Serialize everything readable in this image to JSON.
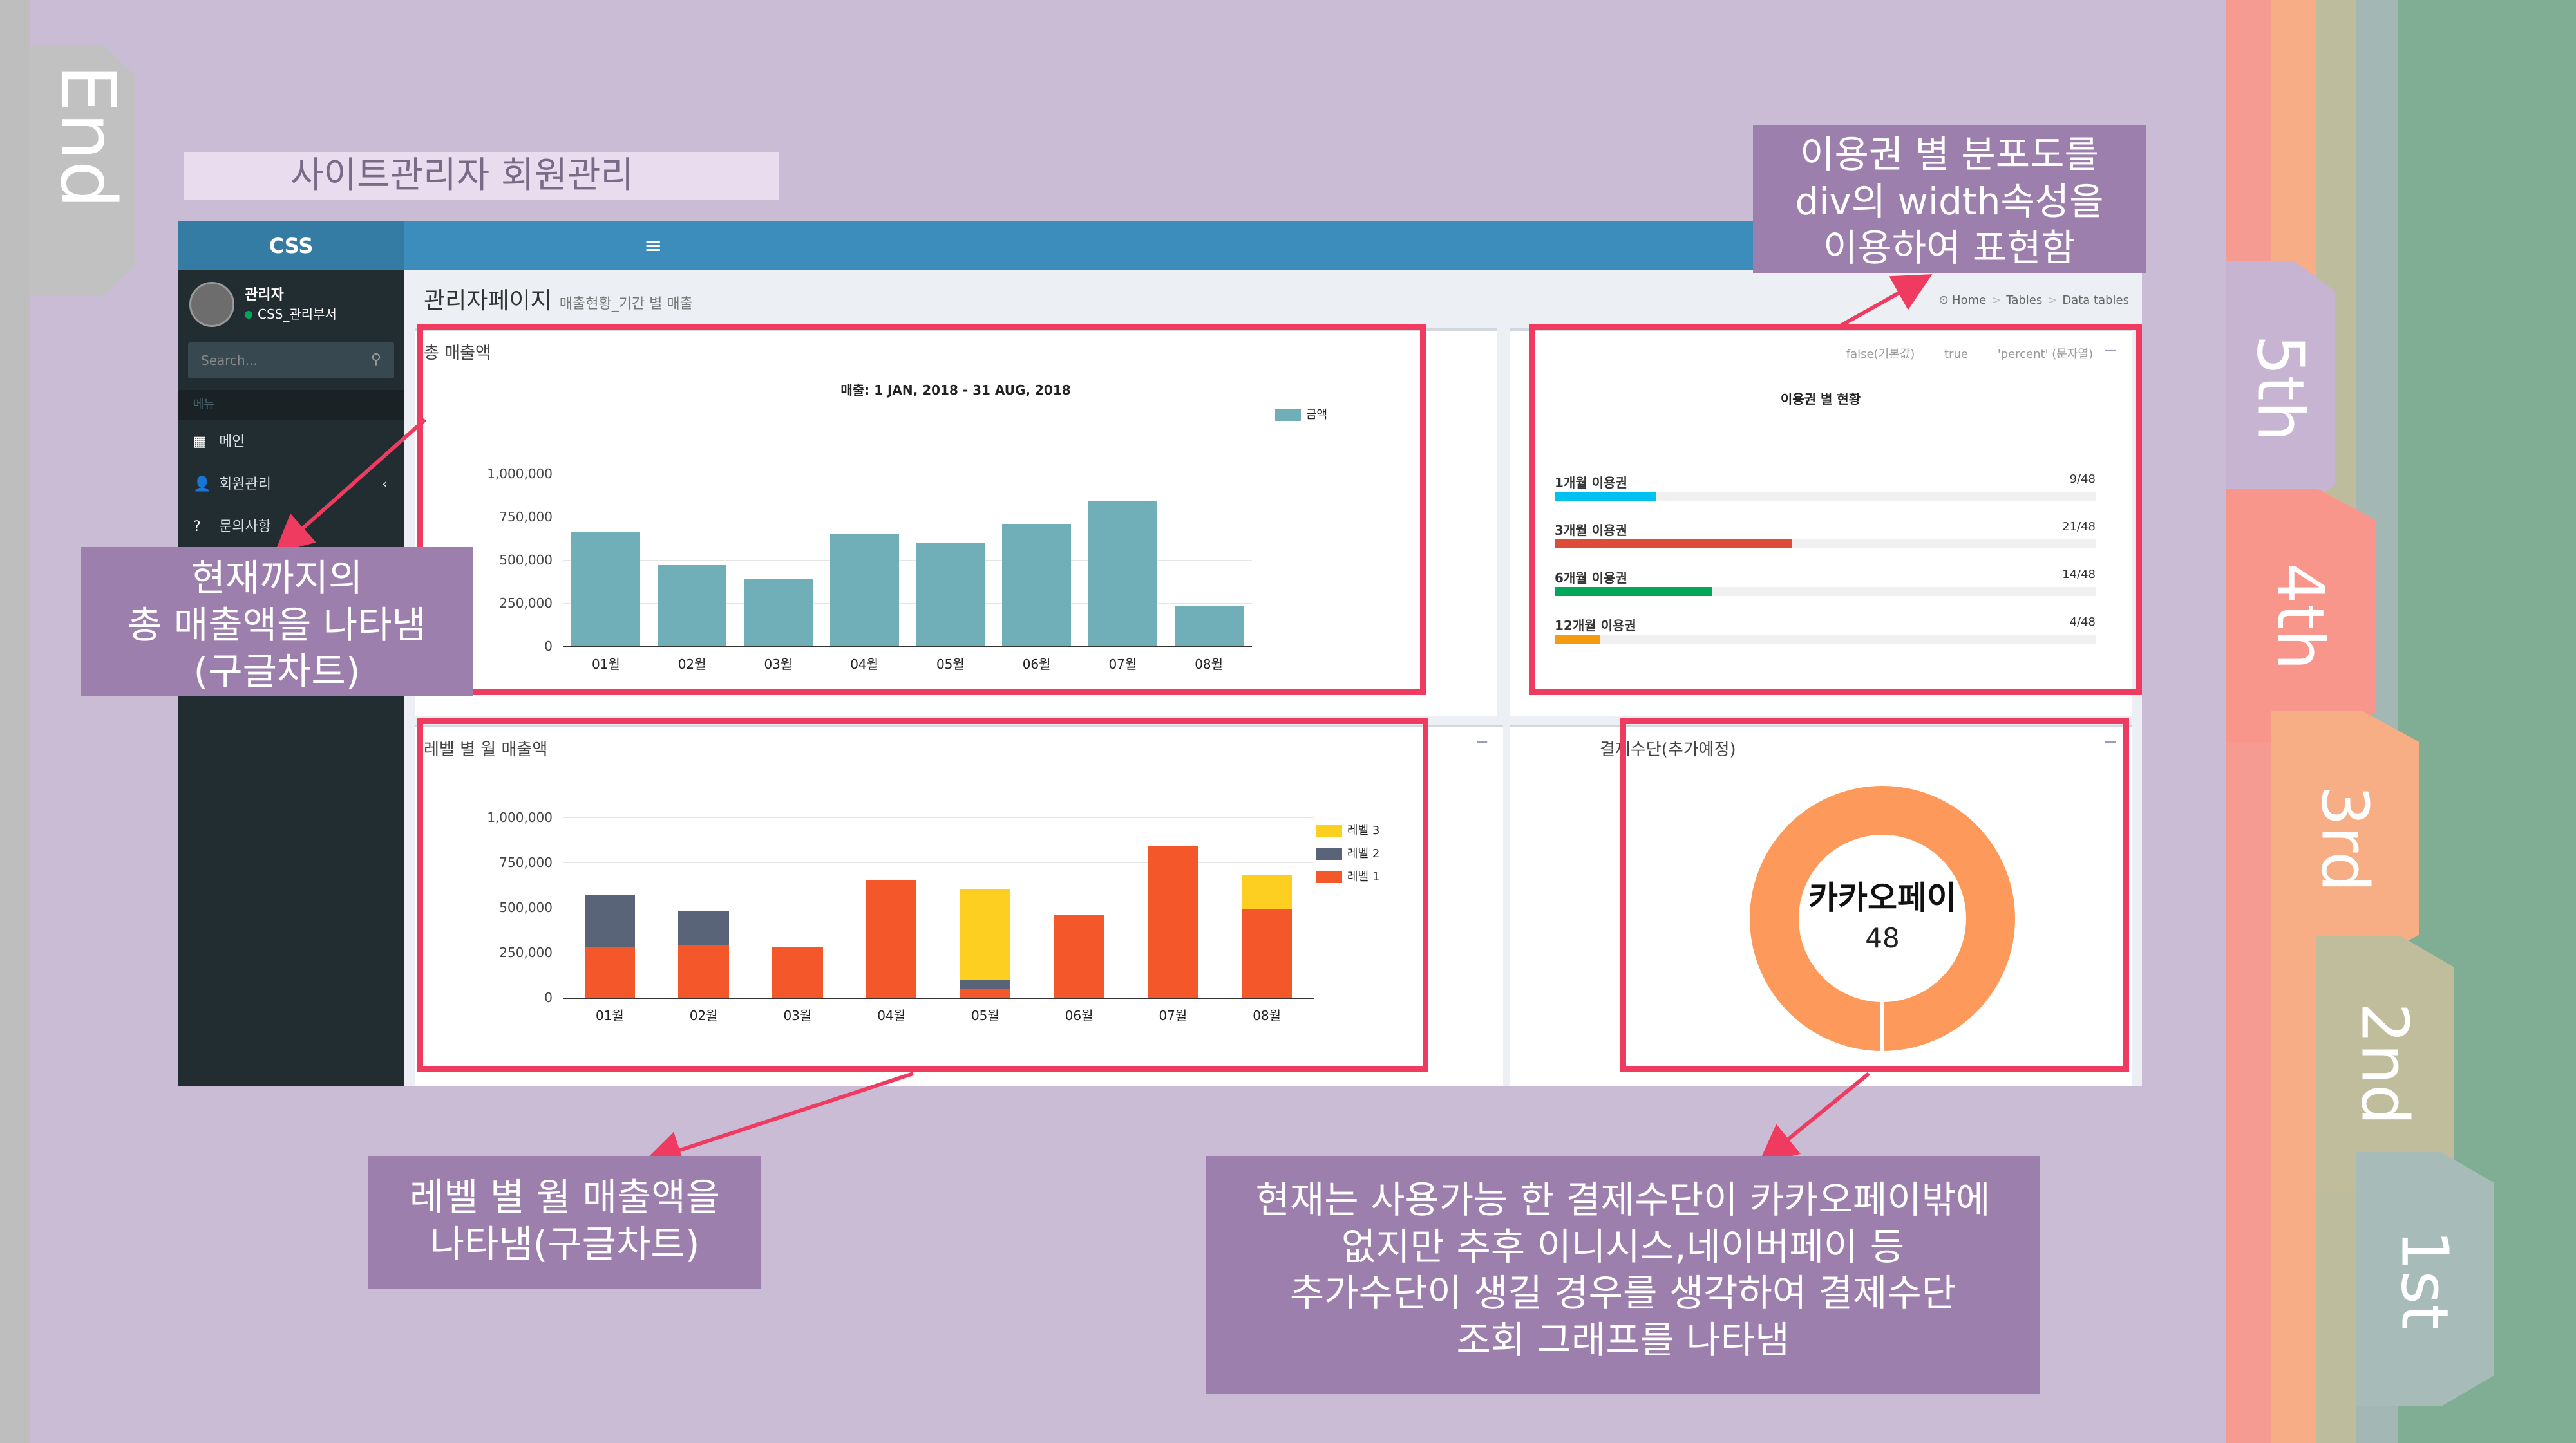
{
  "slide": {
    "title": "사이트관리자 회원관리",
    "end_tab": "End",
    "tabs": [
      "5th",
      "4th",
      "3rd",
      "2nd",
      "1st"
    ]
  },
  "admin": {
    "logo": "CSS",
    "hamburger": "≡",
    "user": {
      "name": "관리자",
      "dept": "CSS_관리부서"
    },
    "search_placeholder": "Search...",
    "menu_header": "메뉴",
    "menu": [
      {
        "icon": "dashboard-icon",
        "glyph": "▦",
        "label": "메인"
      },
      {
        "icon": "user-icon",
        "glyph": "👤",
        "label": "회원관리",
        "chevron": "‹"
      },
      {
        "icon": "question-icon",
        "glyph": "?",
        "label": "문의사항"
      }
    ],
    "page_title": "관리자페이지",
    "page_subtitle": "매출현황_기간 별 매출",
    "breadcrumb": [
      "Home",
      "Tables",
      "Data tables"
    ],
    "breadcrumb_icon": "⏲",
    "total_sales_box": {
      "title": "총 매출액",
      "chart_title": "매출: 1 JAN, 2018 - 31 AUG, 2018"
    },
    "membership_box": {
      "title": "이용권 별 현황",
      "tools": [
        "false(기본값)",
        "true",
        "'percent' (문자열)"
      ],
      "collapse": "−",
      "items": [
        {
          "label": "1개월 이용권",
          "value": "9/48",
          "ratio": 0.1875,
          "color": "#00c0ef"
        },
        {
          "label": "3개월 이용권",
          "value": "21/48",
          "ratio": 0.4375,
          "color": "#dd4b39"
        },
        {
          "label": "6개월 이용권",
          "value": "14/48",
          "ratio": 0.2917,
          "color": "#00a65a"
        },
        {
          "label": "12개월 이용권",
          "value": "4/48",
          "ratio": 0.0833,
          "color": "#f39c12"
        }
      ]
    },
    "level_box": {
      "title": "레벨 별 월 매출액",
      "collapse": "−"
    },
    "payment_box": {
      "title": "결제수단(추가예정)",
      "collapse": "−",
      "method": "카카오페이",
      "count": "48",
      "color": "#fd9a5b"
    }
  },
  "annotations": {
    "total_sales": "현재까지의\n총 매출액을 나타냄\n(구글차트)",
    "membership": "이용권 별 분포도를\ndiv의 width속성을\n이용하여 표현함",
    "level_sales": "레벨 별 월 매출액을\n나타냄(구글차트)",
    "payment": "현재는 사용가능 한 결제수단이 카카오페이밖에\n없지만 추후 이니시스,네이버페이 등\n추가수단이 생길 경우를 생각하여 결제수단\n조회 그래프를 나타냄"
  },
  "chart_data": [
    {
      "type": "bar",
      "title": "매출: 1 JAN, 2018 - 31 AUG, 2018",
      "categories": [
        "01월",
        "02월",
        "03월",
        "04월",
        "05월",
        "06월",
        "07월",
        "08월"
      ],
      "series": [
        {
          "name": "금액",
          "values": [
            660000,
            470000,
            390000,
            650000,
            600000,
            710000,
            840000,
            230000
          ],
          "color": "#70aeb8"
        }
      ],
      "yticks": [
        "0",
        "250,000",
        "500,000",
        "750,000",
        "1,000,000"
      ],
      "ylim": [
        0,
        1000000
      ],
      "grid": true,
      "legend": "right"
    },
    {
      "type": "bar",
      "stacked": true,
      "categories": [
        "01월",
        "02월",
        "03월",
        "04월",
        "05월",
        "06월",
        "07월",
        "08월"
      ],
      "series": [
        {
          "name": "레벨 1",
          "values": [
            280000,
            290000,
            280000,
            650000,
            50000,
            460000,
            840000,
            490000
          ],
          "color": "#f4572a"
        },
        {
          "name": "레벨 2",
          "values": [
            290000,
            190000,
            0,
            0,
            50000,
            0,
            0,
            0
          ],
          "color": "#5a6478"
        },
        {
          "name": "레벨 3",
          "values": [
            0,
            0,
            0,
            0,
            500000,
            0,
            0,
            190000
          ],
          "color": "#fccf21"
        }
      ],
      "yticks": [
        "0",
        "250,000",
        "500,000",
        "750,000",
        "1,000,000"
      ],
      "ylim": [
        0,
        1000000
      ],
      "grid": true,
      "legend": "right"
    },
    {
      "type": "pie",
      "donut": true,
      "categories": [
        "카카오페이"
      ],
      "values": [
        48
      ],
      "colors": [
        "#fd9a5b"
      ]
    }
  ]
}
